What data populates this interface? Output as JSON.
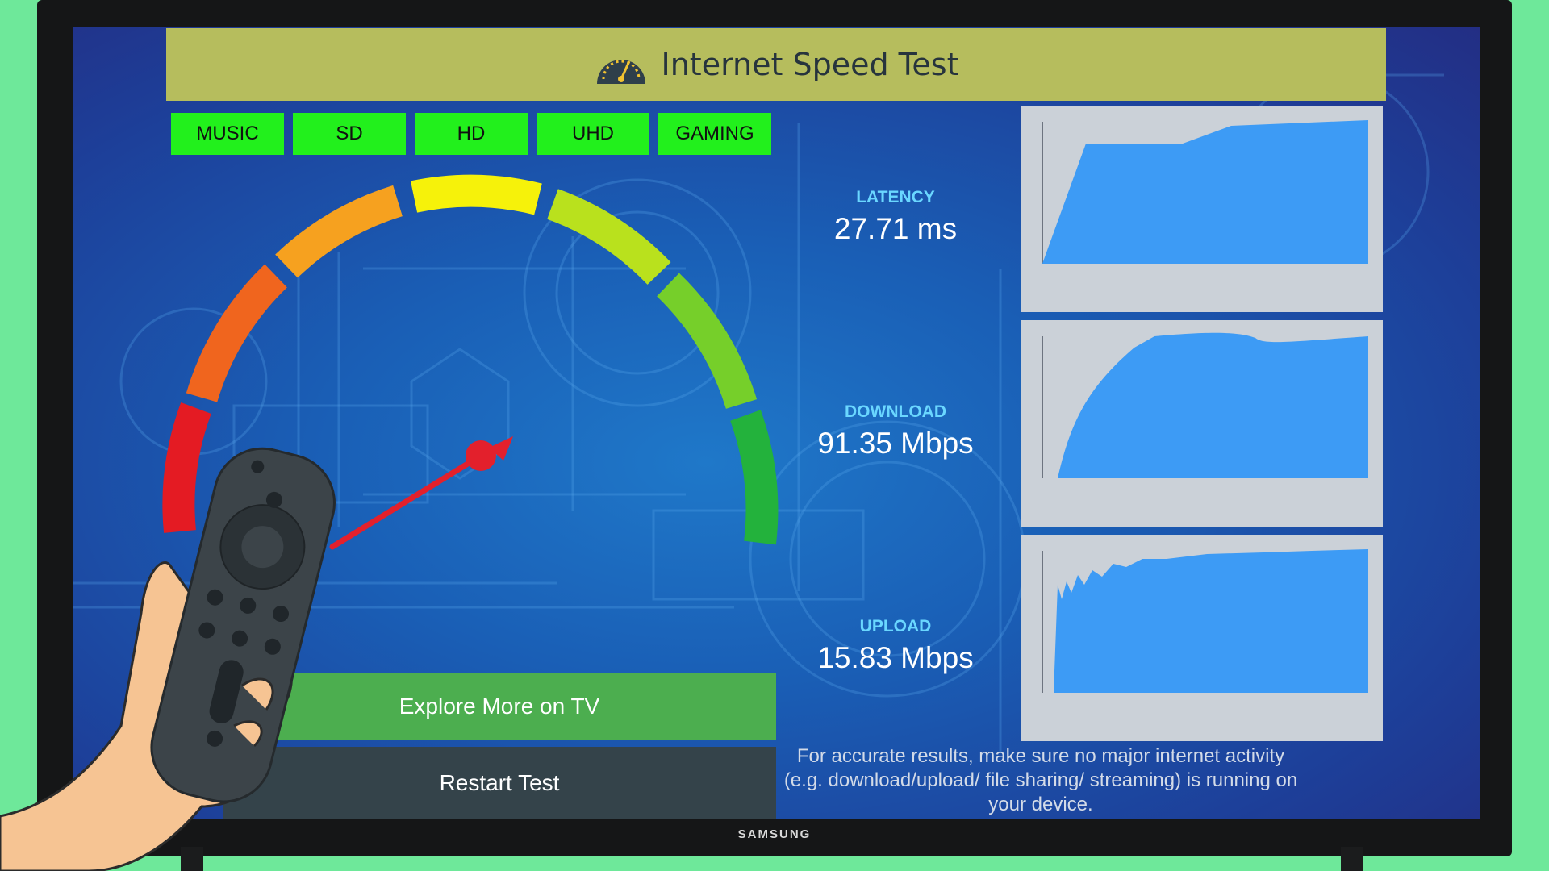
{
  "tv": {
    "brand": "SAMSUNG"
  },
  "app": {
    "title": "Internet Speed Test",
    "logo_icon": "speedometer-icon",
    "categories": [
      "MUSIC",
      "SD",
      "HD",
      "UHD",
      "GAMING"
    ]
  },
  "metrics": {
    "latency": {
      "label": "LATENCY",
      "value": "27.71 ms"
    },
    "download": {
      "label": "DOWNLOAD",
      "value": "91.35 Mbps"
    },
    "upload": {
      "label": "UPLOAD",
      "value": "15.83 Mbps"
    }
  },
  "actions": {
    "explore_label": "Explore More on TV",
    "restart_label": "Restart Test"
  },
  "notice": "For accurate results, make sure no major internet activity (e.g. download/upload/ file sharing/ streaming) is running on your device.",
  "colors": {
    "title_bar": "#b6bd5d",
    "category_button": "#22f01c",
    "metric_label": "#6ad7ff",
    "graph_fill": "#3d9bf5",
    "explore_button": "#4cae4f",
    "restart_button": "#34434a",
    "needle": "#e3202c"
  }
}
